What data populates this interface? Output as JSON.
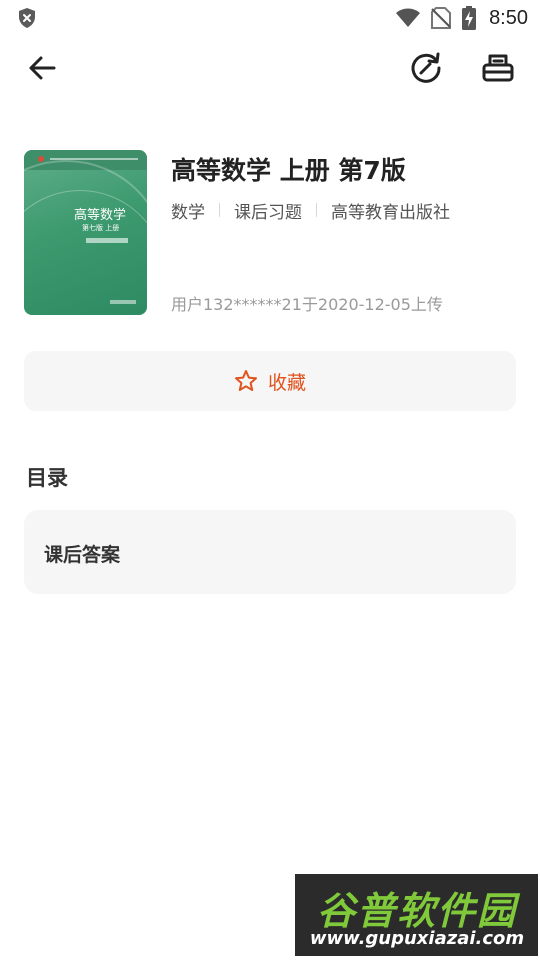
{
  "status_bar": {
    "time": "8:50",
    "icons": [
      "shield-icon",
      "wifi-icon",
      "no-sim-icon",
      "battery-charging-icon"
    ]
  },
  "toolbar": {
    "icons": [
      "back-arrow-icon",
      "refresh-icon",
      "print-icon"
    ]
  },
  "book": {
    "title": "高等数学 上册 第7版",
    "tags": [
      "数学",
      "课后习题",
      "高等教育出版社"
    ],
    "uploader": "用户132******21于2020-12-05上传",
    "cover": {
      "title": "高等数学",
      "edition": "第七版 上册"
    }
  },
  "favorite": {
    "label": "收藏",
    "icon": "star-outline-icon",
    "accent_color": "#e0531d"
  },
  "contents": {
    "heading": "目录",
    "items": [
      {
        "label": "课后答案"
      }
    ]
  },
  "watermark": {
    "text": "谷普软件园",
    "url": "www.gupuxiazai.com"
  }
}
